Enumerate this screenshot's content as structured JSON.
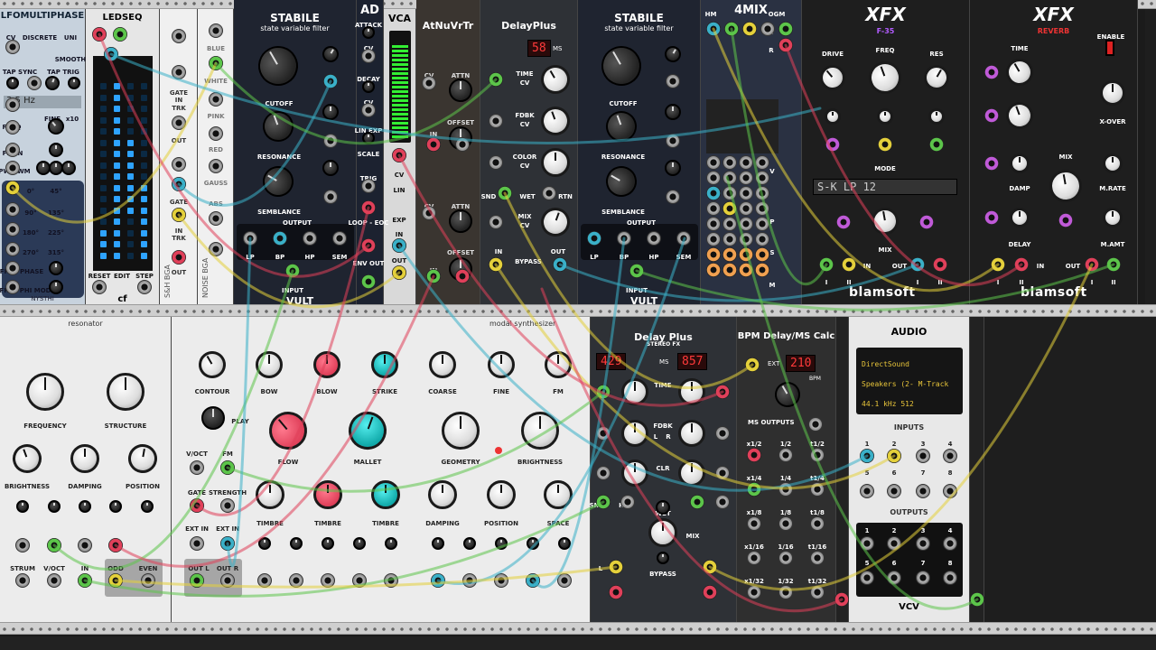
{
  "rails": [
    "rack-rail-top",
    "rack-rail-middle",
    "rack-rail-bottom"
  ],
  "lfo": {
    "title": "LFOMULTIPHASE",
    "labels": [
      "CV",
      "DISCRETE",
      "UNI",
      "SMOOTH",
      "TAP SYNC",
      "TAP TRIG",
      "FREQ",
      "FINE",
      "x10",
      "FM IN",
      "PW-PWM",
      "0°",
      "45°",
      "90°",
      "135°",
      "180°",
      "225°",
      "270°",
      "315°",
      "FREE PHASE",
      "FREE PHI MOD"
    ],
    "freq_display": "3.5 Hz",
    "brand": "NYSTHI"
  },
  "ledseq": {
    "title": "LEDSEQ",
    "labels": [
      "RESET",
      "EDIT",
      "STEP"
    ],
    "brand": "cf"
  },
  "gates": {
    "labels": [
      "GATE",
      "IN",
      "TRK",
      "OUT",
      "GATE",
      "IN",
      "TRK",
      "OUT"
    ],
    "side": "S&H BGA"
  },
  "noise": {
    "labels": [
      "BLUE",
      "WHITE",
      "PINK",
      "RED",
      "GAUSS",
      "ABS"
    ],
    "side": "NOISE BGA"
  },
  "stabile1": {
    "title": "STABILE",
    "subtitle": "state variable filter",
    "labels": [
      "CUTOFF",
      "RESONANCE",
      "SEMBLANCE",
      "OUTPUT",
      "LP",
      "BP",
      "HP",
      "SEM",
      "INPUT"
    ],
    "brand": "VULT"
  },
  "ad": {
    "title": "AD",
    "labels": [
      "ATTACK",
      "CV",
      "DECAY",
      "CV",
      "LIN EXP",
      "SCALE",
      "TRIG",
      "LOOP - EOC",
      "ENV OUT"
    ],
    "brand": "NYSTHI"
  },
  "vca": {
    "title": "VCA",
    "labels": [
      "CV",
      "LIN",
      "EXP",
      "IN",
      "OUT"
    ]
  },
  "atnu": {
    "title": "AtNuVrTr",
    "labels": [
      "CV",
      "ATTN",
      "OFFSET",
      "IN",
      "OUT",
      "CV",
      "ATTN",
      "OFFSET",
      "IN",
      "OUT"
    ]
  },
  "delay1": {
    "title": "DelayPlus",
    "sub": "FX",
    "display": "58",
    "unit": "MS",
    "labels": [
      "TIME",
      "CV",
      "FDBK",
      "CV",
      "COLOR",
      "CV",
      "MIX",
      "CV",
      "SND",
      "WET",
      "RTN",
      "IN",
      "BYPASS",
      "OUT"
    ]
  },
  "stabile2": {
    "title": "STABILE",
    "subtitle": "state variable filter",
    "labels": [
      "CUTOFF",
      "RESONANCE",
      "SEMBLANCE",
      "OUTPUT",
      "LP",
      "BP",
      "HP",
      "SEM",
      "INPUT"
    ],
    "brand": "VULT"
  },
  "mix4": {
    "title": "4MIX",
    "labels": [
      "HM",
      "OGM",
      "L",
      "R",
      "V",
      "P",
      "S",
      "M"
    ],
    "brand": "NYSTHI"
  },
  "f35": {
    "title": "XFX",
    "sub": "F-35",
    "labels": [
      "DRIVE",
      "FREQ",
      "RES",
      "MODE",
      "MIX",
      "IN",
      "OUT",
      "I",
      "II",
      "I",
      "II"
    ],
    "display": "S-K  LP 12",
    "brand": "blamsoft"
  },
  "reverb": {
    "title": "XFX",
    "sub": "REVERB",
    "labels": [
      "TIME",
      "ENABLE",
      "MID",
      "LOW",
      "X-OVER",
      "MIX",
      "DAMP",
      "M.RATE",
      "DELAY",
      "M.AMT",
      "IN",
      "OUT",
      "I",
      "II",
      "I",
      "II"
    ],
    "brand": "blamsoft"
  },
  "resonator": {
    "title": "resonator",
    "labels": [
      "FREQUENCY",
      "STRUCTURE",
      "BRIGHTNESS",
      "DAMPING",
      "POSITION",
      "STRUM",
      "V/OCT",
      "IN",
      "ODD",
      "EVEN"
    ]
  },
  "modal": {
    "title": "modal synthesizer",
    "labels": [
      "CONTOUR",
      "BOW",
      "BLOW",
      "STRIKE",
      "COARSE",
      "FINE",
      "FM",
      "PLAY",
      "FLOW",
      "MALLET",
      "GEOMETRY",
      "BRIGHTNESS",
      "V/OCT",
      "FM",
      "GATE",
      "STRENGTH",
      "TIMBRE",
      "TIMBRE",
      "TIMBRE",
      "DAMPING",
      "POSITION",
      "SPACE",
      "EXT IN",
      "EXT IN",
      "OUT L",
      "OUT R"
    ]
  },
  "delay2": {
    "title": "Delay Plus",
    "sub": "STEREO FX",
    "display_l": "429",
    "unit": "MS",
    "display_r": "857",
    "labels": [
      "TIME",
      "FDBK",
      "L",
      "R",
      "CLR",
      "WET",
      "SND",
      "RTN",
      "MIX",
      "BYPASS",
      "L",
      "R"
    ]
  },
  "bpm": {
    "title": "BPM Delay/MS Calc",
    "ext": "EXT",
    "display": "210",
    "bpm": "BPM",
    "outs_title": "MS OUTPUTS",
    "rows": [
      "x1/2",
      "1/2",
      "t1/2",
      "x1/4",
      "1/4",
      "t1/4",
      "x1/8",
      "1/8",
      "t1/8",
      "x1/16",
      "1/16",
      "t1/16",
      "x1/32",
      "1/32",
      "t1/32"
    ]
  },
  "audio": {
    "title": "AUDIO",
    "lines": [
      "DirectSound",
      "Speakers (2- M-Track",
      "44.1 kHz   512"
    ],
    "inputs": "INPUTS",
    "outputs": "OUTPUTS",
    "nums": [
      "1",
      "2",
      "3",
      "4",
      "5",
      "6",
      "7",
      "8"
    ],
    "brand": "VCV"
  }
}
